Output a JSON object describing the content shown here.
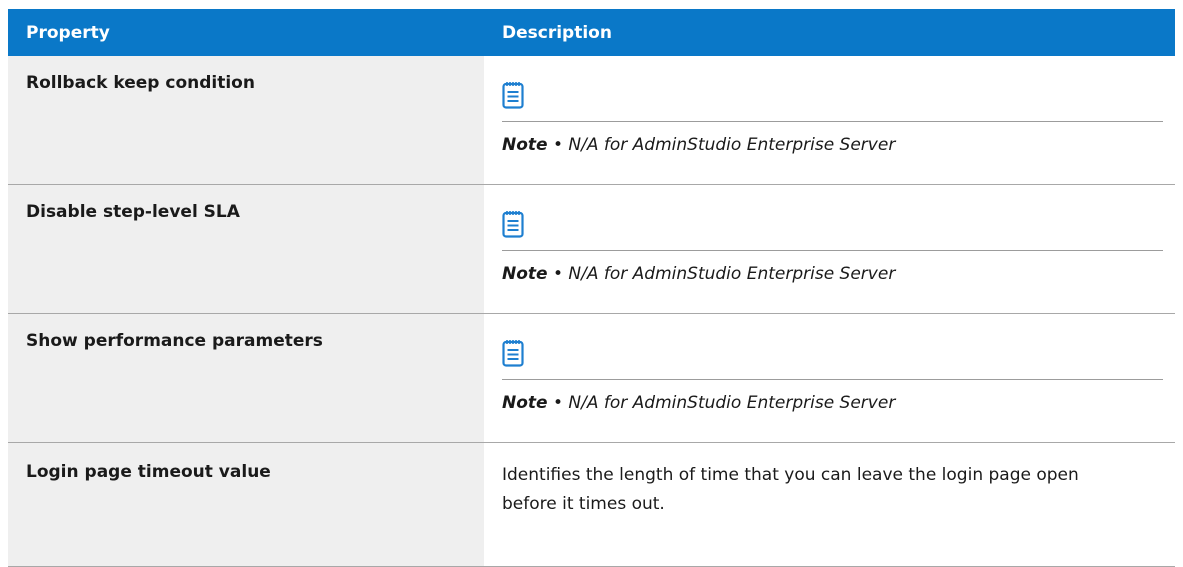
{
  "header": {
    "property": "Property",
    "description": "Description"
  },
  "rows": [
    {
      "property": "Rollback keep condition",
      "note_label": "Note",
      "note_bullet": "•",
      "note_text": "N/A for AdminStudio Enterprise Server"
    },
    {
      "property": "Disable step-level SLA",
      "note_label": "Note",
      "note_bullet": "•",
      "note_text": "N/A for AdminStudio Enterprise Server"
    },
    {
      "property": "Show performance parameters",
      "note_label": "Note",
      "note_bullet": "•",
      "note_text": "N/A for AdminStudio Enterprise Server"
    },
    {
      "property": "Login page timeout value",
      "description": "Identifies the length of time that you can leave the login page open before it times out."
    }
  ],
  "icons": {
    "note": "notepad-icon"
  },
  "colors": {
    "header_bg": "#0a78c8",
    "property_bg": "#efefef",
    "icon": "#1e7fd0"
  }
}
